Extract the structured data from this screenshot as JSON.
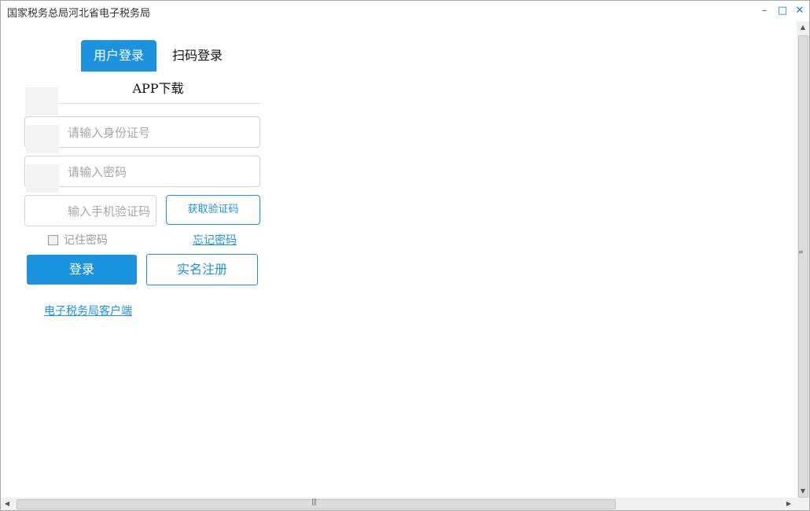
{
  "window": {
    "title": "国家税务总局河北省电子税务局",
    "minimize_icon": "minimize-icon",
    "maximize_icon": "maximize-icon",
    "close_icon": "close-icon"
  },
  "tabs": [
    {
      "label": "用户登录",
      "active": true
    },
    {
      "label": "扫码登录",
      "active": false
    }
  ],
  "app_download": "APP下载",
  "form": {
    "id_placeholder": "请输入身份证号",
    "id_value": "",
    "password_placeholder": "请输入密码",
    "password_value": "",
    "sms_placeholder": "输入手机验证码",
    "sms_value": "",
    "sms_button": "获取验证码",
    "remember_label": "记住密码",
    "remember_checked": false,
    "forgot_link": "忘记密码",
    "login_button": "登录",
    "register_button": "实名注册"
  },
  "client_link": "电子税务局客户端",
  "colors": {
    "accent": "#1b93de",
    "border": "#d4d4d4",
    "placeholder": "#a6a6a6"
  }
}
